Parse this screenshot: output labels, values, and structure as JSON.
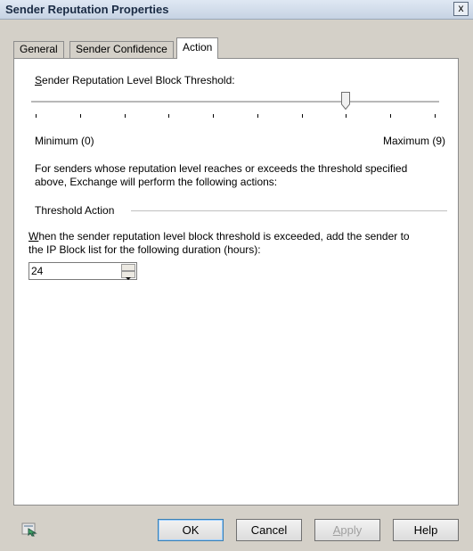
{
  "window": {
    "title": "Sender Reputation Properties",
    "close_glyph": "x"
  },
  "tabs": [
    {
      "label": "General",
      "active": false
    },
    {
      "label": "Sender Confidence",
      "active": false
    },
    {
      "label": "Action",
      "active": true
    }
  ],
  "slider": {
    "label_prefix": "S",
    "label_rest": "ender Reputation Level Block Threshold:",
    "min_label": "Minimum (0)",
    "max_label": "Maximum (9)",
    "value": 7,
    "min": 0,
    "max": 9
  },
  "description": {
    "line1": "For senders whose reputation level reaches or exceeds the threshold specified",
    "line2": "above, Exchange will perform the following actions:"
  },
  "threshold_action": {
    "header": "Threshold Action",
    "text_prefix": "W",
    "text_line1_rest": "hen the sender reputation level block threshold is exceeded, add the sender to",
    "text_line2": "the IP Block list for the following duration (hours):",
    "duration_value": "24"
  },
  "buttons": {
    "ok": "OK",
    "cancel": "Cancel",
    "apply_prefix": "A",
    "apply_rest": "pply",
    "help": "Help"
  },
  "icons": {
    "help": "context-help-icon"
  }
}
